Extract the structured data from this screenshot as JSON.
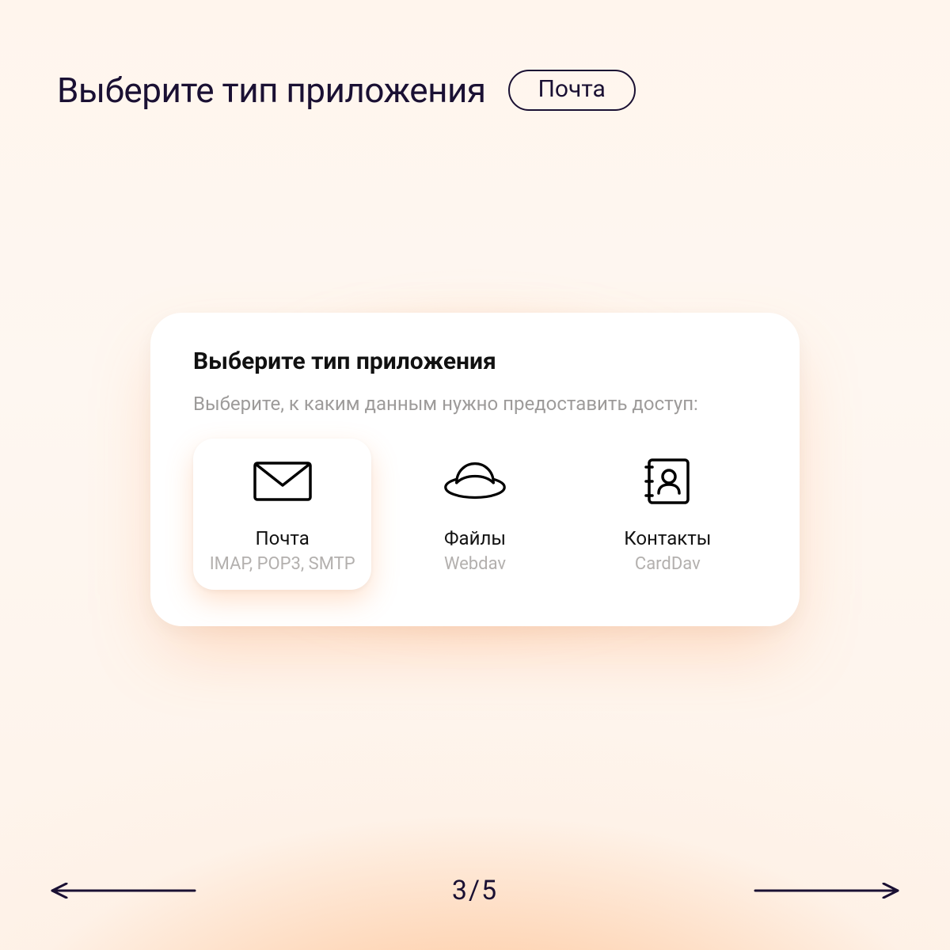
{
  "header": {
    "title": "Выберите тип приложения",
    "chip": "Почта"
  },
  "card": {
    "title": "Выберите тип приложения",
    "subtitle": "Выберите, к каким данным нужно предоставить доступ:",
    "options": [
      {
        "icon": "mail-icon",
        "label": "Почта",
        "sub": "IMAP, POP3, SMTP",
        "selected": true
      },
      {
        "icon": "ufo-icon",
        "label": "Файлы",
        "sub": "Webdav",
        "selected": false
      },
      {
        "icon": "contacts-icon",
        "label": "Контакты",
        "sub": "CardDav",
        "selected": false
      }
    ]
  },
  "pager": {
    "current": 3,
    "total": 5,
    "indicator": "3/5"
  }
}
